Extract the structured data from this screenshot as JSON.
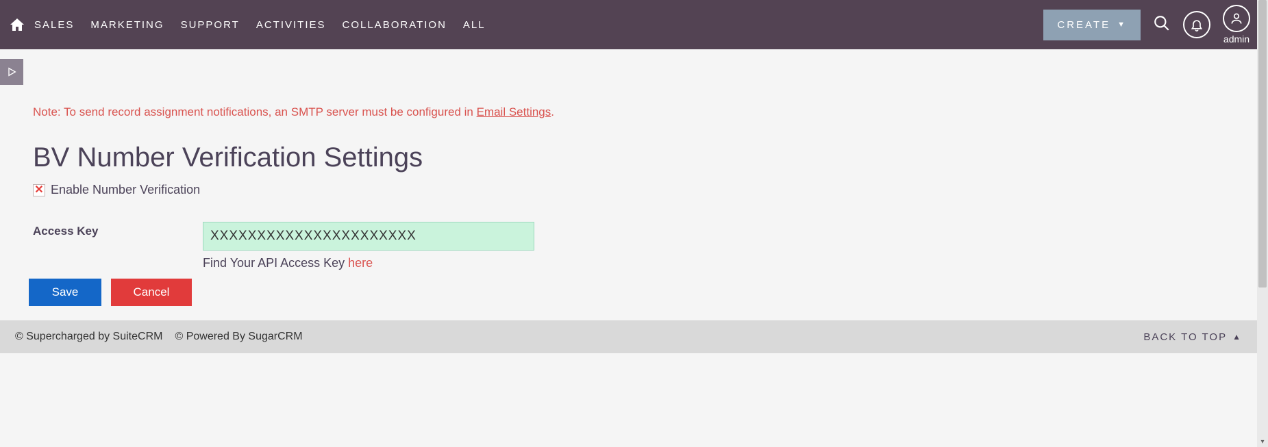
{
  "nav": {
    "items": [
      "SALES",
      "MARKETING",
      "SUPPORT",
      "ACTIVITIES",
      "COLLABORATION",
      "ALL"
    ],
    "create_label": "CREATE",
    "user_label": "admin"
  },
  "notice": {
    "prefix": "Note: To send record assignment notifications, an SMTP server must be configured in ",
    "link_text": "Email Settings",
    "suffix": "."
  },
  "page_title": "BV Number Verification Settings",
  "enable": {
    "label": "Enable Number Verification",
    "checked_glyph": "✕"
  },
  "access_key": {
    "label": "Access Key",
    "value": "XXXXXXXXXXXXXXXXXXXXXX",
    "helper_prefix": "Find Your API Access Key ",
    "helper_link": "here"
  },
  "buttons": {
    "save": "Save",
    "cancel": "Cancel"
  },
  "footer": {
    "left1": "© Supercharged by SuiteCRM",
    "left2": "© Powered By SugarCRM",
    "back_to_top": "BACK TO TOP"
  }
}
